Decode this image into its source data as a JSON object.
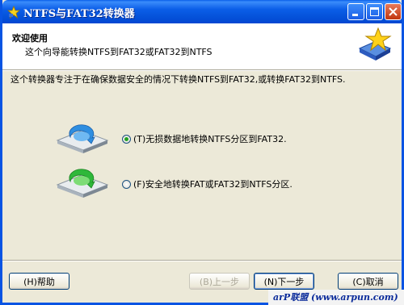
{
  "window": {
    "title": "NTFS与FAT32转换器"
  },
  "header": {
    "title": "欢迎使用",
    "subtitle": "这个向导能转换NTFS到FAT32或FAT32到NTFS"
  },
  "description": "这个转换器专注于在确保数据安全的情况下转换NTFS到FAT32,或转换FAT32到NTFS.",
  "options": [
    {
      "label": "(T)无损数据地转换NTFS分区到FAT32.",
      "selected": true
    },
    {
      "label": "(F)安全地转换FAT或FAT32到NTFS分区.",
      "selected": false
    }
  ],
  "buttons": {
    "help": "(H)帮助",
    "back": "(B)上一步",
    "next": "(N)下一步",
    "cancel": "(C)取消"
  },
  "watermark": "arP联盟 (www.arpun.com)"
}
